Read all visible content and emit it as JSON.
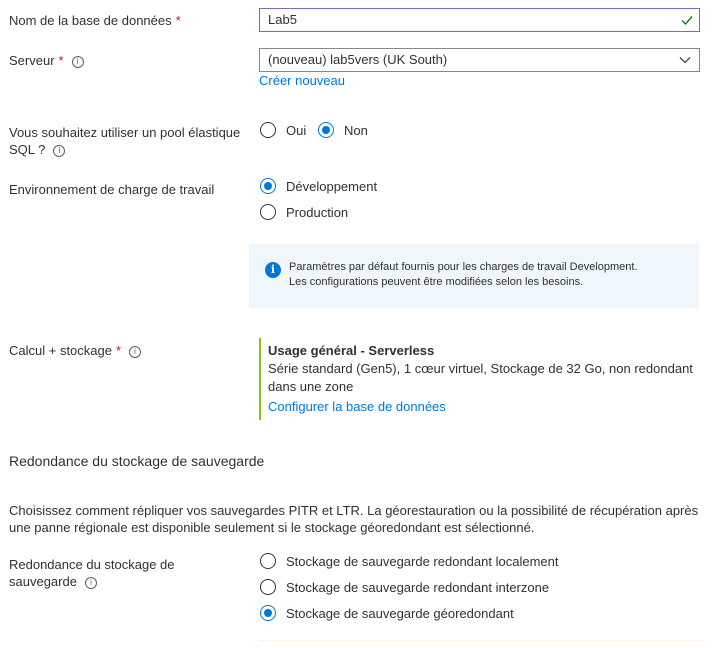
{
  "db_name": {
    "label": "Nom de la base de données",
    "required": "*",
    "value": "Lab5"
  },
  "server": {
    "label": "Serveur",
    "required": "*",
    "value": "(nouveau) lab5vers (UK South)",
    "create_link": "Créer nouveau"
  },
  "elastic_pool": {
    "label_line1": "Vous souhaitez utiliser un pool élastique",
    "label_line2": "SQL ?",
    "options": [
      "Oui",
      "Non"
    ],
    "selected": "Non"
  },
  "workload": {
    "label": "Environnement de charge de travail",
    "options": [
      "Développement",
      "Production"
    ],
    "selected": "Développement",
    "info_line1": "Paramètres par défaut fournis pour les charges de travail Development.",
    "info_line2": "Les configurations peuvent être modifiées selon les besoins."
  },
  "compute": {
    "label": "Calcul + stockage",
    "required": "*",
    "title": "Usage général - Serverless",
    "desc_line1": "Série standard (Gen5), 1 cœur virtuel, Stockage de 32 Go, non redondant",
    "desc_line2": "dans une zone",
    "configure_link": "Configurer la base de données"
  },
  "backup": {
    "section_title": "Redondance du stockage de sauvegarde",
    "desc_line1": "Choisissez comment répliquer vos sauvegardes PITR et LTR. La géorestauration ou la possibilité de récupération après",
    "desc_line2": "une panne régionale est disponible seulement si le stockage géoredondant est sélectionné.",
    "label_line1": "Redondance du stockage de",
    "label_line2": "sauvegarde",
    "options": [
      "Stockage de sauvegarde redondant localement",
      "Stockage de sauvegarde redondant interzone",
      "Stockage de sauvegarde géoredondant"
    ],
    "selected": "Stockage de sauvegarde géoredondant"
  },
  "colors": {
    "accent": "#0078d4",
    "valid": "#107c10",
    "focus_border": "#8764b8",
    "compute_bar": "#8cbd18",
    "info_bg": "#eff6fc"
  }
}
